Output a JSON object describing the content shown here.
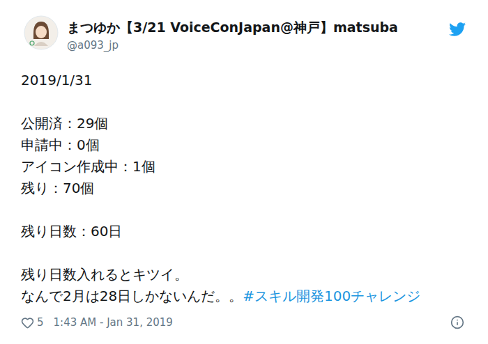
{
  "tweet": {
    "author": {
      "name": "まつゆか【3/21 VoiceConJapan@神戸】matsuba",
      "handle": "@a093_jp"
    },
    "lines": [
      [
        {
          "kind": "text",
          "text": "2019/1/31"
        }
      ],
      [],
      [
        {
          "kind": "text",
          "text": "公開済：29個"
        }
      ],
      [
        {
          "kind": "text",
          "text": "申請中：0個"
        }
      ],
      [
        {
          "kind": "text",
          "text": "アイコン作成中：1個"
        }
      ],
      [
        {
          "kind": "text",
          "text": "残り：70個"
        }
      ],
      [],
      [
        {
          "kind": "text",
          "text": "残り日数：60日"
        }
      ],
      [],
      [
        {
          "kind": "text",
          "text": "残り日数入れるとキツイ。"
        }
      ],
      [
        {
          "kind": "text",
          "text": "なんで2月は28日しかないんだ。。"
        },
        {
          "kind": "hashtag",
          "text": "#スキル開発100チャレンジ"
        }
      ]
    ],
    "likes": "5",
    "liked": false,
    "timestamp": "1:43 AM - Jan 31, 2019"
  }
}
